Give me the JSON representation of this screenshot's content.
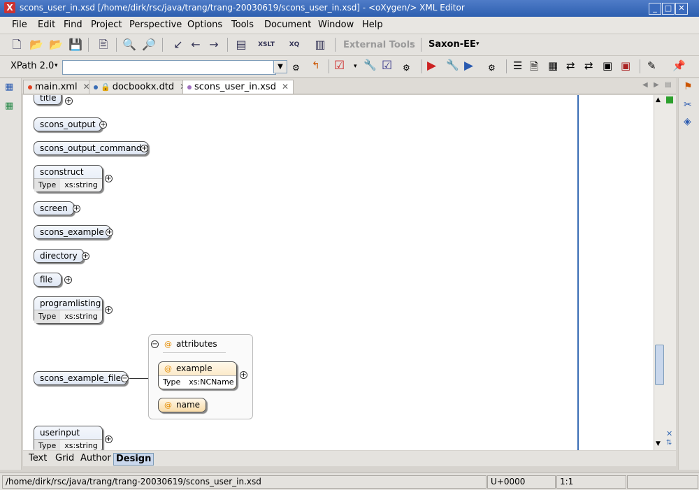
{
  "window": {
    "title": "scons_user_in.xsd [/home/dirk/rsc/java/trang/trang-20030619/scons_user_in.xsd] - <oXygen/> XML Editor"
  },
  "menu": [
    "File",
    "Edit",
    "Find",
    "Project",
    "Perspective",
    "Options",
    "Tools",
    "Document",
    "Window",
    "Help"
  ],
  "toolbar": {
    "external_tools": "External Tools",
    "transformer": "Saxon-EE",
    "xpath_version": "XPath 2.0",
    "xpath_value": ""
  },
  "tabs": [
    {
      "label": "main.xml",
      "dot": "#e04020"
    },
    {
      "label": "docbookx.dtd",
      "dot": "#3a6db5"
    },
    {
      "label": "scons_user_in.xsd",
      "dot": "#a070c0"
    }
  ],
  "diagram": {
    "elements": [
      {
        "name": "title"
      },
      {
        "name": "scons_output"
      },
      {
        "name": "scons_output_command"
      },
      {
        "name": "sconstruct",
        "type_label": "Type",
        "type": "xs:string"
      },
      {
        "name": "screen"
      },
      {
        "name": "scons_example"
      },
      {
        "name": "directory"
      },
      {
        "name": "file"
      },
      {
        "name": "programlisting",
        "type_label": "Type",
        "type": "xs:string"
      },
      {
        "name": "scons_example_file"
      },
      {
        "name": "userinput",
        "type_label": "Type",
        "type": "xs:string"
      }
    ],
    "attributes_group": "attributes",
    "attributes": [
      {
        "name": "example",
        "type_label": "Type",
        "type": "xs:NCName"
      },
      {
        "name": "name"
      }
    ]
  },
  "modes": [
    "Text",
    "Grid",
    "Author",
    "Design"
  ],
  "active_mode": "Design",
  "status": {
    "path": "/home/dirk/rsc/java/trang/trang-20030619/scons_user_in.xsd",
    "char": "U+0000",
    "position": "1:1"
  }
}
